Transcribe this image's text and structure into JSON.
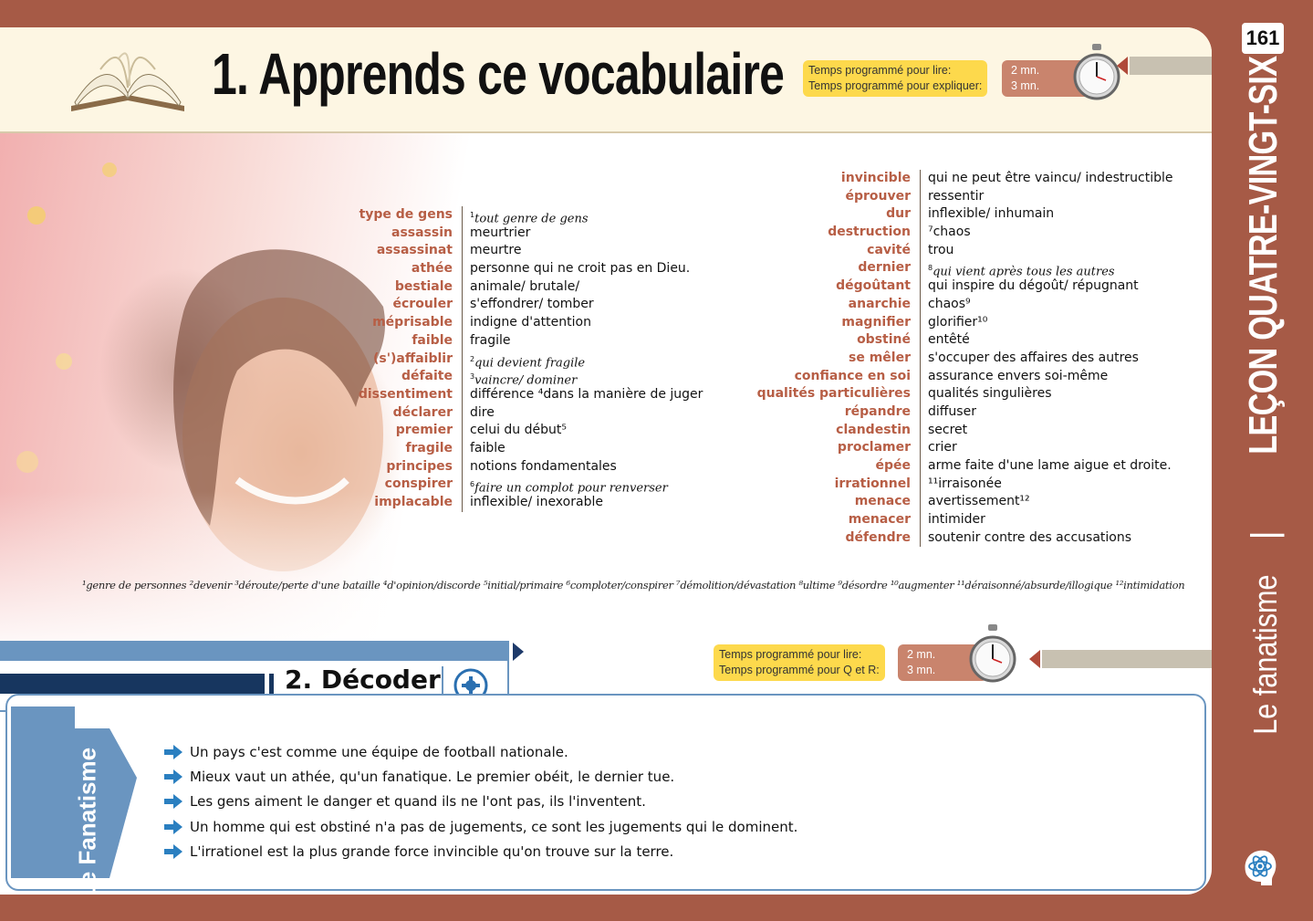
{
  "page_number": "161",
  "side": {
    "lesson": "LEÇON QUATRE-VINGT-SIX",
    "separator": "|",
    "theme": "Le fanatisme"
  },
  "section1": {
    "title": "1. Apprends ce vocabulaire",
    "timer": {
      "label_read": "Temps programmé pour lire:",
      "label_explain": "Temps programmé pour expliquer:",
      "value_read": "2 mn.",
      "value_explain": "3 mn."
    },
    "vocab_left": [
      {
        "term": "type  de gens",
        "sup": "1",
        "def": "tout genre de gens",
        "def_italic": true
      },
      {
        "term": "assassin",
        "def": "meurtrier"
      },
      {
        "term": "assassinat",
        "def": "meurtre"
      },
      {
        "term": "athée",
        "def": "personne qui ne croit pas en Dieu."
      },
      {
        "term": "bestiale",
        "def": "animale/ brutale/"
      },
      {
        "term": "écrouler",
        "def": "s'effondrer/ tomber"
      },
      {
        "term": "méprisable",
        "def": "indigne d'attention"
      },
      {
        "term": "faible",
        "def": "fragile"
      },
      {
        "term": "(s')affaiblir",
        "sup": "2",
        "def": "qui devient fragile",
        "def_italic": true
      },
      {
        "term": "défaite",
        "sup": "3",
        "def": "vaincre/ dominer",
        "def_italic": true
      },
      {
        "term": "dissentiment",
        "def": "différence ⁴dans la manière de juger"
      },
      {
        "term": "déclarer",
        "def": "dire"
      },
      {
        "term": "premier",
        "def": "celui du début⁵"
      },
      {
        "term": "fragile",
        "def": "faible"
      },
      {
        "term": "principes",
        "def": "notions fondamentales"
      },
      {
        "term": "conspirer",
        "sup": "6",
        "def": "faire un complot pour renverser",
        "def_italic": true
      },
      {
        "term": "implacable",
        "def": "inflexible/ inexorable"
      }
    ],
    "vocab_right": [
      {
        "term": "invincible",
        "def": "qui ne peut être vaincu/ indestructible"
      },
      {
        "term": "éprouver",
        "def": "ressentir"
      },
      {
        "term": "dur",
        "def": "inflexible/ inhumain"
      },
      {
        "term": "destruction",
        "def": "⁷chaos"
      },
      {
        "term": "cavité",
        "def": "trou"
      },
      {
        "term": "dernier",
        "sup": "8",
        "def": "qui vient après tous les autres",
        "def_italic": true
      },
      {
        "term": "dégoûtant",
        "def": "qui inspire du dégoût/ répugnant"
      },
      {
        "term": "anarchie",
        "def": "chaos⁹"
      },
      {
        "term": "magnifier",
        "def": "glorifier¹⁰"
      },
      {
        "term": "obstiné",
        "def": "entêté"
      },
      {
        "term": "se mêler",
        "def": "s'occuper des affaires des autres"
      },
      {
        "term": "confiance en soi",
        "def": "assurance envers soi-même"
      },
      {
        "term": "qualités particulières",
        "def": "qualités singulières"
      },
      {
        "term": "répandre",
        "def": "diffuser"
      },
      {
        "term": "clandestin",
        "def": "secret"
      },
      {
        "term": "proclamer",
        "def": "crier"
      },
      {
        "term": "épée",
        "def": "arme faite d'une lame aigue et droite."
      },
      {
        "term": "irrationnel",
        "def": "¹¹irraisonée"
      },
      {
        "term": "menace",
        "def": "avertissement¹²"
      },
      {
        "term": "menacer",
        "def": "intimider"
      },
      {
        "term": "défendre",
        "def": "soutenir contre des accusations"
      }
    ],
    "footnotes": "¹genre de personnes  ²devenir  ³déroute/perte d'une bataille  ⁴d'opinion/discorde  ⁵initial/primaire  ⁶comploter/conspirer  ⁷démolition/dévastation  ⁸ultime  ⁹désordre  ¹⁰augmenter  ¹¹déraisonné/absurde/illogique  ¹²intimidation"
  },
  "section2": {
    "title": "2. Décoder",
    "timer": {
      "label_read": "Temps programmé pour lire:",
      "label_qr": "Temps programmé pour Q et R:",
      "value_read": "2 mn.",
      "value_qr": "3 mn."
    },
    "tab_label": "Le Fanatisme",
    "quotes": [
      "Un pays c'est comme une équipe de football nationale.",
      "Mieux vaut un athée, qu'un fanatique. Le premier obéit, le dernier tue.",
      "Les gens aiment le danger et quand ils ne l'ont pas, ils l'inventent.",
      "Un homme qui est obstiné n'a pas de jugements, ce sont les jugements qui le dominent.",
      "L'irrationel est la plus grande force invincible qu'on trouve sur la terre."
    ]
  },
  "colors": {
    "frame": "#a65a46",
    "term": "#b75e45",
    "timer_label_bg": "#fdd94c",
    "timer_value_bg": "#c9846d",
    "section2_dark": "#17365f",
    "section2_light": "#6a95c0",
    "quote_arrow": "#2a7fc0"
  },
  "icons": [
    "book-icon",
    "stopwatch-icon",
    "decode-icon",
    "arrow-bullet-icon",
    "brain-atom-icon"
  ]
}
